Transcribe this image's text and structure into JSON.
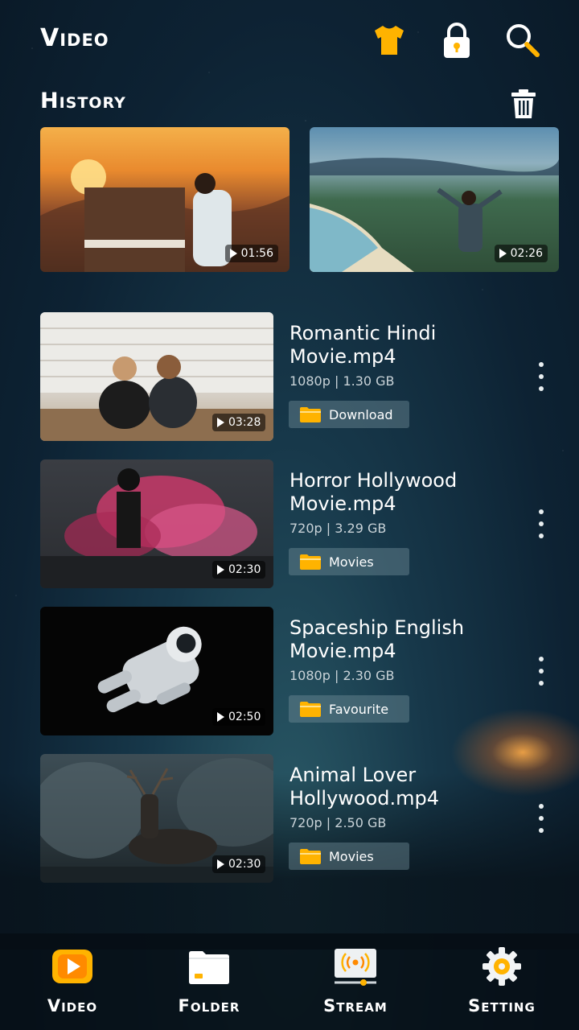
{
  "header": {
    "title": "Video",
    "icons": [
      "theme-shirt-icon",
      "lock-icon",
      "search-icon"
    ]
  },
  "history": {
    "title": "History",
    "items": [
      {
        "duration": "01:56"
      },
      {
        "duration": "02:26"
      }
    ]
  },
  "videos": [
    {
      "title": "Romantic Hindi Movie.mp4",
      "resolution": "1080p",
      "size": "1.30 GB",
      "meta": "1080p  |  1.30 GB",
      "folder": "Download",
      "duration": "03:28"
    },
    {
      "title": "Horror Hollywood Movie.mp4",
      "resolution": "720p",
      "size": "3.29 GB",
      "meta": "720p  |  3.29 GB",
      "folder": "Movies",
      "duration": "02:30"
    },
    {
      "title": "Spaceship English Movie.mp4",
      "resolution": "1080p",
      "size": "2.30 GB",
      "meta": "1080p  |  2.30 GB",
      "folder": "Favourite",
      "duration": "02:50"
    },
    {
      "title": "Animal Lover Hollywood.mp4",
      "resolution": "720p",
      "size": "2.50 GB",
      "meta": "720p  |  2.50 GB",
      "folder": "Movies",
      "duration": "02:30"
    }
  ],
  "bottom_nav": [
    {
      "label": "Video",
      "icon": "video-play-icon",
      "active": true
    },
    {
      "label": "Folder",
      "icon": "folder-icon",
      "active": false
    },
    {
      "label": "Stream",
      "icon": "stream-icon",
      "active": false
    },
    {
      "label": "Setting",
      "icon": "gear-icon",
      "active": false
    }
  ],
  "colors": {
    "accent": "#FFB300",
    "chip": "#6E8C96",
    "bg_dark": "#0D2233"
  }
}
